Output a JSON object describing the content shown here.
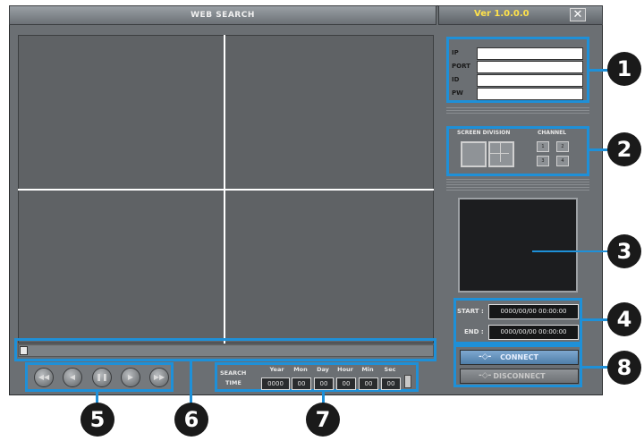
{
  "window": {
    "title": "WEB SEARCH",
    "version": "Ver 1.0.0.0",
    "close_label": "✕"
  },
  "login": {
    "labels": [
      "IP",
      "PORT",
      "ID",
      "PW"
    ]
  },
  "screen_division": {
    "label": "SCREEN DIVISION"
  },
  "channel": {
    "label": "CHANNEL",
    "buttons": [
      "1",
      "2",
      "3",
      "4"
    ]
  },
  "time": {
    "start_label": "START :",
    "end_label": "END :",
    "start_value": "0000/00/00 00:00:00",
    "end_value": "0000/00/00 00:00:00"
  },
  "conn": {
    "connect_label": "CONNECT",
    "disconnect_label": "DISCONNECT"
  },
  "search": {
    "label_line1": "SEARCH",
    "label_line2": "TIME",
    "fields": [
      "Year",
      "Mon",
      "Day",
      "Hour",
      "Min",
      "Sec"
    ],
    "values": [
      "0000",
      "00",
      "00",
      "00",
      "00",
      "00"
    ]
  },
  "callouts": [
    "1",
    "2",
    "3",
    "4",
    "5",
    "6",
    "7",
    "8"
  ],
  "colors": {
    "highlight": "#1e90d8",
    "version": "#ffe24a"
  }
}
